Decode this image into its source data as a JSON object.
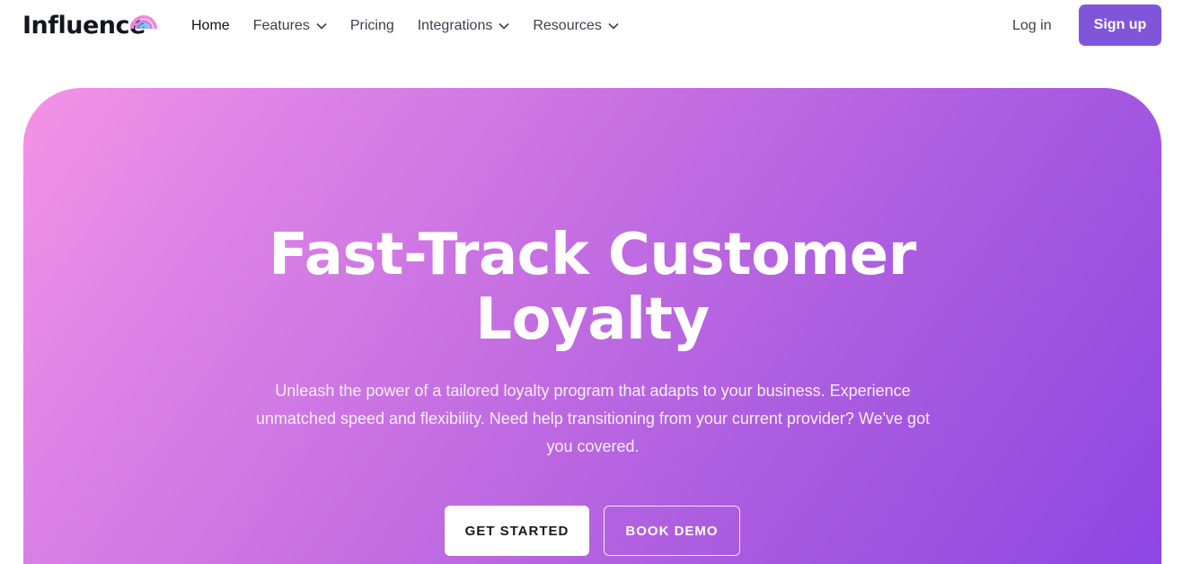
{
  "nav": {
    "logo_text": "Influence",
    "items": [
      {
        "label": "Home",
        "dropdown": false,
        "active": true
      },
      {
        "label": "Features",
        "dropdown": true
      },
      {
        "label": "Pricing",
        "dropdown": false
      },
      {
        "label": "Integrations",
        "dropdown": true
      },
      {
        "label": "Resources",
        "dropdown": true
      }
    ],
    "login_label": "Log in",
    "signup_label": "Sign up"
  },
  "hero": {
    "title_line1": "Fast-Track Customer",
    "title_line2": "Loyalty",
    "subtitle": "Unleash the power of a tailored loyalty program that adapts to your business. Experience unmatched speed and flexibility. Need help transitioning from your current provider? We've got you covered.",
    "primary_cta": "GET STARTED",
    "secondary_cta": "BOOK DEMO"
  },
  "colors": {
    "brand_purple": "#7f56d9",
    "hero_gradient_start": "#f592e6",
    "hero_gradient_end": "#8e46e2",
    "text_dark": "#15151f"
  },
  "icons": {
    "logo_mark": "rainbow-arc-icon",
    "dropdown": "chevron-down-icon"
  }
}
